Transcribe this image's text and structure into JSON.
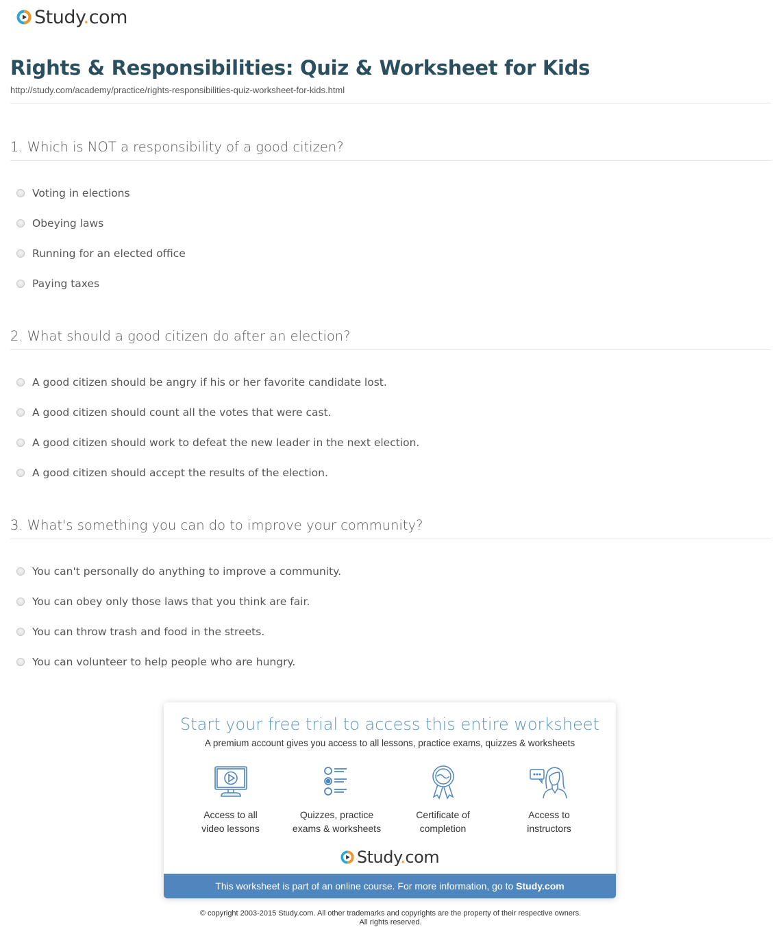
{
  "header": {
    "logo_text_main": "Study",
    "logo_text_dot": ".",
    "logo_text_tld": "com"
  },
  "page": {
    "title": "Rights & Responsibilities: Quiz & Worksheet for Kids",
    "url": "http://study.com/academy/practice/rights-responsibilities-quiz-worksheet-for-kids.html"
  },
  "questions": [
    {
      "text": "1. Which is NOT a responsibility of a good citizen?",
      "answers": [
        "Voting in elections",
        "Obeying laws",
        "Running for an elected office",
        "Paying taxes"
      ]
    },
    {
      "text": "2. What should a good citizen do after an election?",
      "answers": [
        "A good citizen should be angry if his or her favorite candidate lost.",
        "A good citizen should count all the votes that were cast.",
        "A good citizen should work to defeat the new leader in the next election.",
        "A good citizen should accept the results of the election."
      ]
    },
    {
      "text": "3. What's something you can do to improve your community?",
      "answers": [
        "You can't personally do anything to improve a community.",
        "You can obey only those laws that you think are fair.",
        "You can throw trash and food in the streets.",
        "You can volunteer to help people who are hungry."
      ]
    }
  ],
  "promo": {
    "title": "Start your free trial to access this entire worksheet",
    "subtitle": "A premium account gives you access to all lessons, practice exams, quizzes & worksheets",
    "features": [
      {
        "icon": "monitor-play-icon",
        "line1": "Access to all",
        "line2": "video lessons"
      },
      {
        "icon": "quiz-list-icon",
        "line1": "Quizzes, practice",
        "line2": "exams & worksheets"
      },
      {
        "icon": "award-ribbon-icon",
        "line1": "Certificate of",
        "line2": "completion"
      },
      {
        "icon": "instructor-chat-icon",
        "line1": "Access to",
        "line2": "instructors"
      }
    ],
    "bar_text": "This worksheet is part of an online course. For more information, go to ",
    "bar_link": "Study.com"
  },
  "footer": {
    "copyright_line1": "© copyright 2003-2015 Study.com. All other trademarks and copyrights are the property of their respective owners.",
    "copyright_line2": "All rights reserved."
  },
  "colors": {
    "brand_blue": "#4f86bd",
    "brand_orange": "#f79421",
    "title_teal": "#2b4f5e",
    "promo_title_blue": "#5b95c2"
  }
}
